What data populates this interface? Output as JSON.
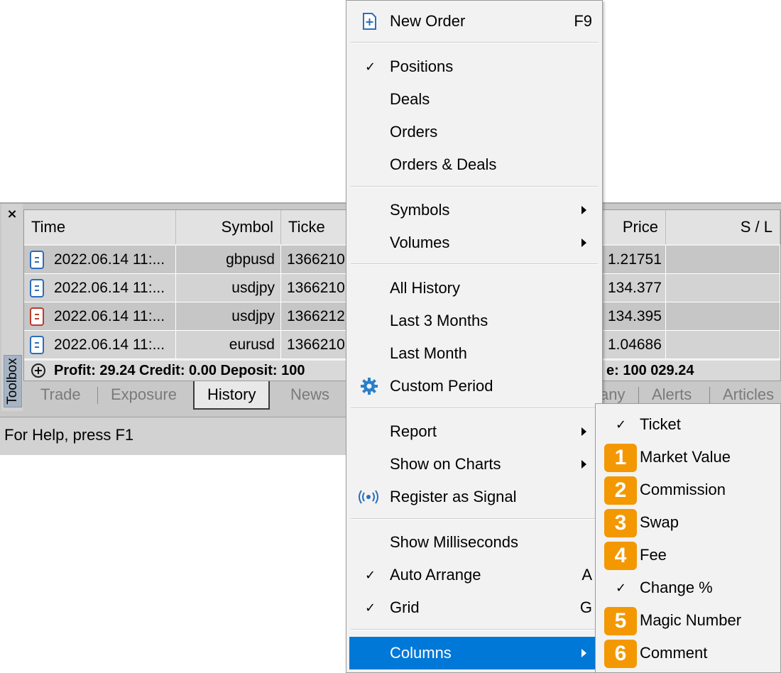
{
  "toolbox": {
    "close_glyph": "×",
    "side_label": "Toolbox",
    "columns": [
      "Time",
      "Symbol",
      "Ticke",
      "Price",
      "S / L"
    ],
    "rows": [
      {
        "time": "2022.06.14 11:...",
        "symbol": "gbpusd",
        "ticket": "1366210",
        "price": "1.21751",
        "icon": "doc-blue-icon"
      },
      {
        "time": "2022.06.14 11:...",
        "symbol": "usdjpy",
        "ticket": "1366210",
        "price": "134.377",
        "icon": "doc-blue-icon"
      },
      {
        "time": "2022.06.14 11:...",
        "symbol": "usdjpy",
        "ticket": "1366212",
        "price": "134.395",
        "icon": "doc-red-icon"
      },
      {
        "time": "2022.06.14 11:...",
        "symbol": "eurusd",
        "ticket": "1366210",
        "price": "1.04686",
        "icon": "doc-blue-icon"
      }
    ],
    "summary_left": "Profit: 29.24  Credit: 0.00  Deposit: 100",
    "summary_right": "e: 100 029.24",
    "tabs": [
      "Trade",
      "Exposure",
      "History",
      "News",
      "any",
      "Alerts",
      "Articles"
    ],
    "active_tab": "History",
    "status": "For Help, press F1"
  },
  "menu": {
    "new_order": {
      "label": "New Order",
      "shortcut": "F9"
    },
    "positions": "Positions",
    "deals": "Deals",
    "orders": "Orders",
    "orders_deals": "Orders & Deals",
    "symbols": "Symbols",
    "volumes": "Volumes",
    "all_history": "All History",
    "last_3_months": "Last 3 Months",
    "last_month": "Last Month",
    "custom_period": "Custom Period",
    "report": "Report",
    "show_on_charts": "Show on Charts",
    "register_signal": "Register as Signal",
    "show_ms": "Show Milliseconds",
    "auto_arrange": {
      "label": "Auto Arrange",
      "shortcut": "A"
    },
    "grid": {
      "label": "Grid",
      "shortcut": "G"
    },
    "columns": "Columns",
    "check_glyph": "✓"
  },
  "submenu": {
    "ticket": "Ticket",
    "market_value": {
      "badge": "1",
      "label": "Market Value"
    },
    "commission": {
      "badge": "2",
      "label": "Commission"
    },
    "swap": {
      "badge": "3",
      "label": "Swap"
    },
    "fee": {
      "badge": "4",
      "label": "Fee"
    },
    "change_pct": "Change %",
    "magic_number": {
      "badge": "5",
      "label": "Magic Number"
    },
    "comment": {
      "badge": "6",
      "label": "Comment"
    }
  },
  "colors": {
    "highlight": "#0078d7",
    "badge": "#f39800"
  }
}
